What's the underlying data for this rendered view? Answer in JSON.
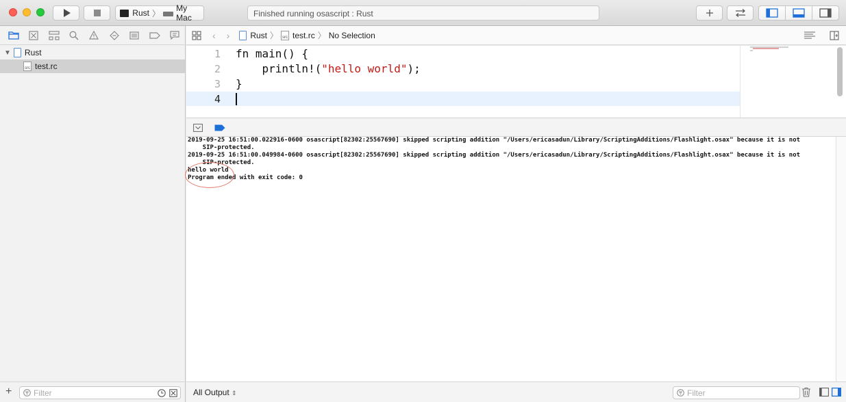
{
  "toolbar": {
    "scheme": "Rust",
    "destination": "My Mac",
    "activity": "Finished running osascript : Rust"
  },
  "navigator": {
    "project": "Rust",
    "file": "test.rc",
    "filter_placeholder": "Filter",
    "file_icon_text": "src"
  },
  "jumpbar": {
    "project": "Rust",
    "file": "test.rc",
    "selection": "No Selection",
    "file_icon_text": "src"
  },
  "editor": {
    "line_numbers": [
      "1",
      "2",
      "3",
      "4"
    ],
    "line1": "fn main() {",
    "line2_pre": "    println!(",
    "line2_str": "\"hello world\"",
    "line2_post": ");",
    "line3": "}"
  },
  "console": {
    "lines": [
      "2019-09-25 16:51:00.022916-0600 osascript[82302:25567690] skipped scripting addition \"/Users/ericasadun/Library/ScriptingAdditions/Flashlight.osax\" because it is not",
      "    SIP-protected.",
      "2019-09-25 16:51:00.049984-0600 osascript[82302:25567690] skipped scripting addition \"/Users/ericasadun/Library/ScriptingAdditions/Flashlight.osax\" because it is not",
      "    SIP-protected.",
      "hello world",
      "Program ended with exit code: 0"
    ]
  },
  "bottom": {
    "output_selector": "All Output",
    "filter_placeholder": "Filter"
  },
  "colors": {
    "accent": "#1e6fd8",
    "string": "#c41a16",
    "annotation_circle": "#e07a6e"
  }
}
